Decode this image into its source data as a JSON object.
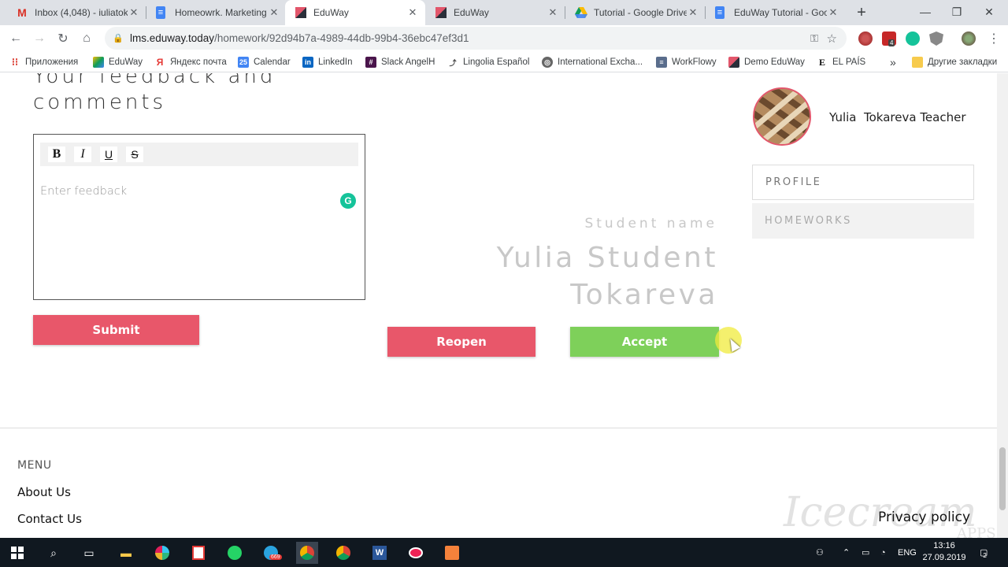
{
  "browser": {
    "tabs": [
      {
        "title": "Inbox (4,048) - iuliatok",
        "icon": "gmail-icon",
        "active": false
      },
      {
        "title": "Homeowrk. Marketing",
        "icon": "docs-icon",
        "active": false
      },
      {
        "title": "EduWay",
        "icon": "eduway-icon",
        "active": true
      },
      {
        "title": "EduWay",
        "icon": "eduway-icon",
        "active": false
      },
      {
        "title": "Tutorial - Google Drive",
        "icon": "drive-icon",
        "active": false
      },
      {
        "title": "EduWay Tutorial - Goo",
        "icon": "docs-icon",
        "active": false
      }
    ],
    "url_host": "lms.eduway.today",
    "url_path": "/homework/92d94b7a-4989-44db-99b4-36ebc47ef3d1",
    "bookmarks": [
      "Приложения",
      "EduWay",
      "Яндекс почта",
      "Calendar",
      "LinkedIn",
      "Slack AngelH",
      "Lingolia Español",
      "International Excha...",
      "WorkFlowy",
      "Demo EduWay",
      "EL PAÍS"
    ],
    "other_bookmarks": "Другие закладки",
    "more": "»",
    "extension_badge": "4"
  },
  "feedback": {
    "heading_line1": "Your feedback and",
    "heading_line2": "comments",
    "toolbar": {
      "bold": "B",
      "italic": "I",
      "underline": "U",
      "strike": "S"
    },
    "placeholder": "Enter feedback",
    "submit_label": "Submit"
  },
  "student": {
    "label": "Student name",
    "name_line1": "Yulia Student",
    "name_line2": "Tokareva"
  },
  "actions": {
    "reopen_label": "Reopen",
    "accept_label": "Accept"
  },
  "sidebar": {
    "teacher_name": "Yulia  Tokareva Teacher",
    "items": [
      {
        "label": "PROFILE"
      },
      {
        "label": "HOMEWORKS"
      }
    ]
  },
  "footer": {
    "menu_label": "MENU",
    "links": [
      "About Us",
      "Contact Us"
    ],
    "privacy": "Privacy policy"
  },
  "watermark": "Icecream",
  "watermark_sub": "APPS",
  "taskbar": {
    "telegram_badge": "669",
    "lang": "ENG",
    "time": "13:16",
    "date": "27.09.2019",
    "notif_badge": "2"
  },
  "colors": {
    "red_button": "#e8576a",
    "green_button": "#7ed05a",
    "muted_text": "#c8c8c8",
    "avatar_border": "#e2566b"
  }
}
